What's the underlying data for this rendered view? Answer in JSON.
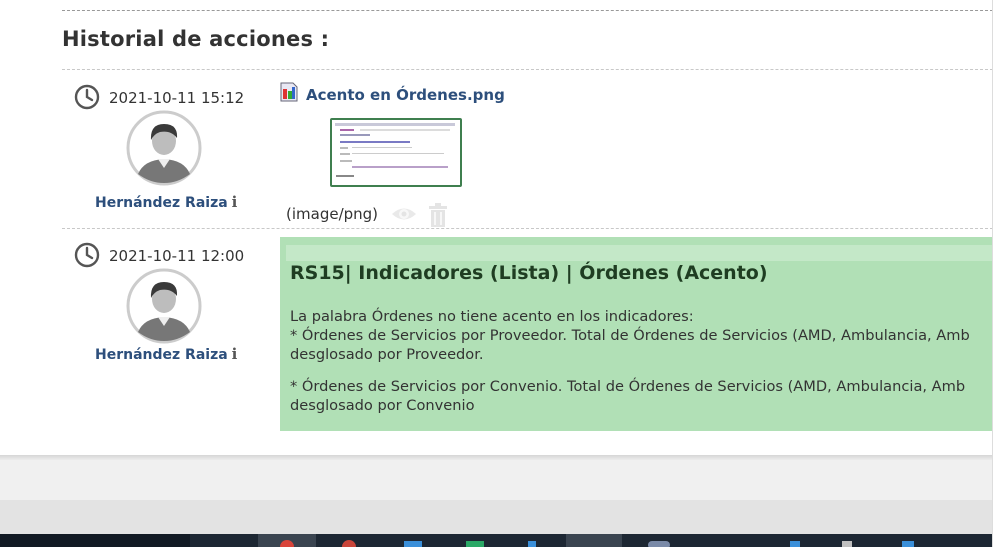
{
  "section": {
    "title": "Historial de acciones :"
  },
  "entries": [
    {
      "timestamp": "2021-10-11 15:12",
      "user": "Hernández Raiza",
      "attachment": {
        "filename": "Acento en Órdenes.png",
        "mime": "(image/png)"
      },
      "icons": [
        "clock-icon",
        "user-avatar-icon",
        "info-icon",
        "image-file-icon",
        "eye-icon",
        "trash-icon"
      ]
    },
    {
      "timestamp": "2021-10-11 12:00",
      "user": "Hernández Raiza",
      "note": {
        "title": "RS15| Indicadores (Lista) | Órdenes (Acento)",
        "line1": "La palabra Órdenes no tiene acento en los indicadores:",
        "line2": "* Órdenes de Servicios por Proveedor. Total de Órdenes de Servicios (AMD, Ambulancia, Amb",
        "line3": "desglosado por Proveedor.",
        "line4": "* Órdenes de Servicios por Convenio. Total de Órdenes de Servicios (AMD, Ambulancia, Amb",
        "line5": "desglosado por Convenio"
      }
    }
  ],
  "colors": {
    "link": "#2d4f7c",
    "note_background": "#b1e0b6",
    "thumbnail_border": "#3f7f4f",
    "taskbar": "#1d2733"
  }
}
